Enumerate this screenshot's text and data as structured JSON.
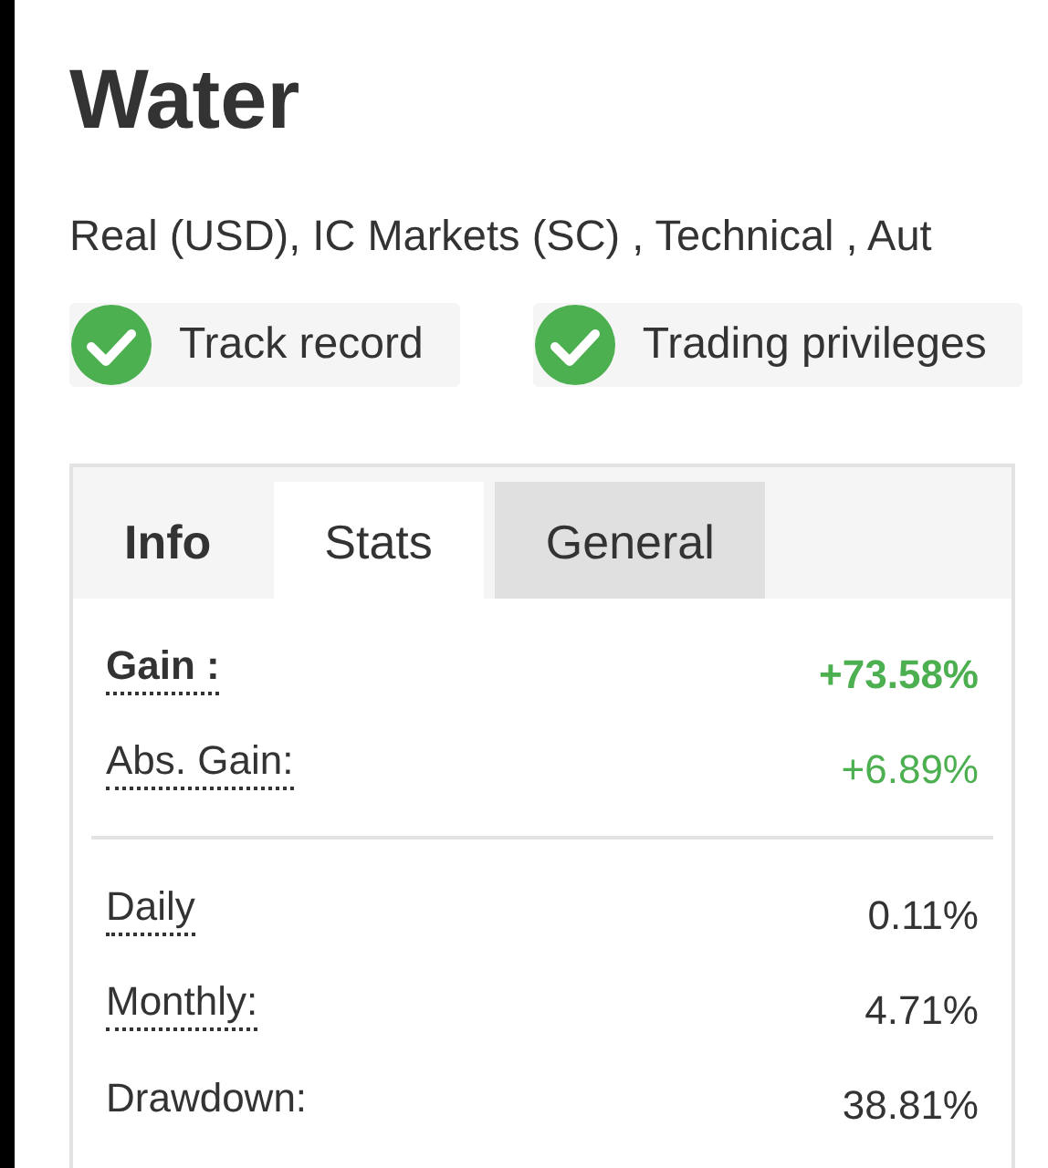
{
  "title": "Water",
  "subtitle": "Real (USD), IC Markets (SC) , Technical , Aut",
  "badges": [
    {
      "label": "Track record",
      "checked": true
    },
    {
      "label": "Trading privileges",
      "checked": true
    }
  ],
  "tabs": [
    {
      "label": "Info",
      "selected": false,
      "hovered": false
    },
    {
      "label": "Stats",
      "selected": true,
      "hovered": false
    },
    {
      "label": "General",
      "selected": false,
      "hovered": true
    }
  ],
  "stat_groups": [
    {
      "rows": [
        {
          "label": "Gain :",
          "value": "+73.58%",
          "bold": true,
          "dotted": true,
          "positive": true
        },
        {
          "label": "Abs. Gain:",
          "value": "+6.89%",
          "bold": false,
          "dotted": true,
          "positive": true
        }
      ]
    },
    {
      "rows": [
        {
          "label": "Daily",
          "value": "0.11%",
          "bold": false,
          "dotted": true,
          "positive": false
        },
        {
          "label": "Monthly:",
          "value": "4.71%",
          "bold": false,
          "dotted": true,
          "positive": false
        },
        {
          "label": "Drawdown:",
          "value": "38.81%",
          "bold": false,
          "dotted": false,
          "positive": false
        }
      ]
    }
  ]
}
